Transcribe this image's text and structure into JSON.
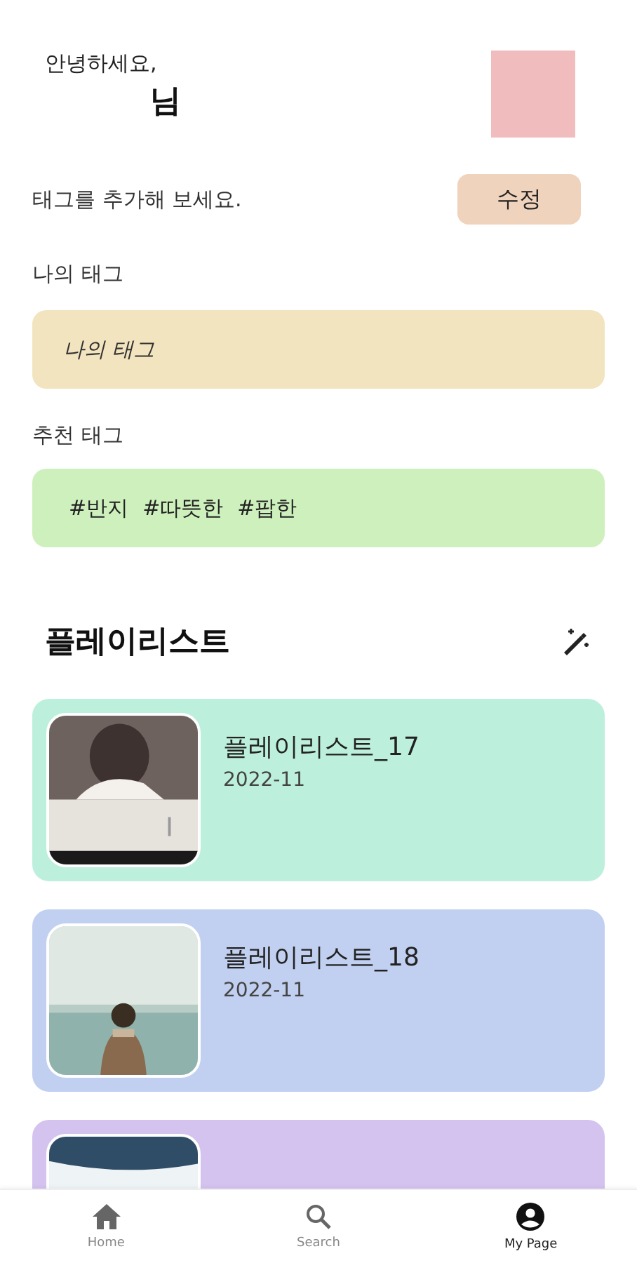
{
  "greeting": {
    "hello": "안녕하세요,",
    "name_suffix": "님"
  },
  "tag_prompt": {
    "text": "태그를 추가해 보세요.",
    "button": "수정"
  },
  "my_tags": {
    "label": "나의 태그",
    "placeholder": "나의 태그"
  },
  "recommended_tags": {
    "label": "추천 태그",
    "tags": [
      "#반지",
      "#따뜻한",
      "#팝한"
    ]
  },
  "playlists": {
    "title": "플레이리스트",
    "items": [
      {
        "title": "플레이리스트_17",
        "date": "2022-11",
        "color": "#bdf0dc"
      },
      {
        "title": "플레이리스트_18",
        "date": "2022-11",
        "color": "#c1d0f0"
      },
      {
        "color": "#d4c3ef"
      }
    ]
  },
  "nav": [
    {
      "label": "Home",
      "kind": "home",
      "selected": false
    },
    {
      "label": "Search",
      "kind": "search",
      "selected": false
    },
    {
      "label": "My Page",
      "kind": "account",
      "selected": true
    }
  ]
}
